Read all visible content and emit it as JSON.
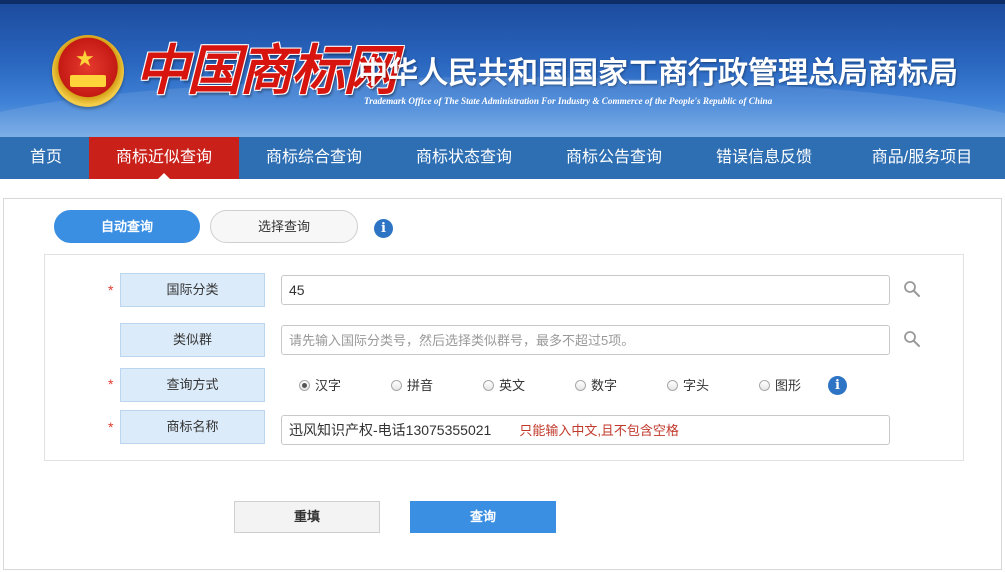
{
  "header": {
    "logo_text": "中国商标网",
    "title_cn": "中华人民共和国国家工商行政管理总局商标局",
    "title_en": "Trademark Office of The State Administration For Industry & Commerce of the People's Republic of China"
  },
  "nav": {
    "items": [
      {
        "label": "首页"
      },
      {
        "label": "商标近似查询"
      },
      {
        "label": "商标综合查询"
      },
      {
        "label": "商标状态查询"
      },
      {
        "label": "商标公告查询"
      },
      {
        "label": "错误信息反馈"
      },
      {
        "label": "商品/服务项目"
      }
    ],
    "active_index": 1
  },
  "tabs": {
    "auto_label": "自动查询",
    "select_label": "选择查询"
  },
  "form": {
    "required_mark": "*",
    "intl_class": {
      "label": "国际分类",
      "value": "45"
    },
    "similar_group": {
      "label": "类似群",
      "placeholder": "请先输入国际分类号，然后选择类似群号，最多不超过5项。"
    },
    "query_mode": {
      "label": "查询方式",
      "options": [
        "汉字",
        "拼音",
        "英文",
        "数字",
        "字头",
        "图形"
      ],
      "selected": "汉字"
    },
    "trademark_name": {
      "label": "商标名称",
      "value": "迅风知识产权-电话13075355021",
      "hint": "只能输入中文,且不包含空格"
    }
  },
  "buttons": {
    "reset_label": "重填",
    "submit_label": "查询"
  },
  "colors": {
    "nav_bg": "#2e6fb3",
    "nav_active": "#c9201a",
    "primary": "#3a8fe3",
    "label_bg": "#dcebfa",
    "required": "#e23b2e"
  }
}
